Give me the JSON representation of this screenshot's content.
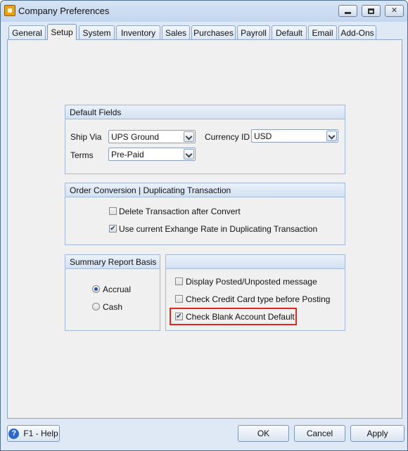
{
  "window": {
    "title": "Company Preferences",
    "close_glyph": "✕",
    "icons": {
      "app": "app-icon",
      "minimize": "minimize-icon",
      "maximize": "maximize-icon",
      "close": "close-icon"
    }
  },
  "tabs": [
    {
      "label": "General"
    },
    {
      "label": "Setup",
      "active": true
    },
    {
      "label": "System"
    },
    {
      "label": "Inventory"
    },
    {
      "label": "Sales"
    },
    {
      "label": "Purchases"
    },
    {
      "label": "Payroll"
    },
    {
      "label": "Default"
    },
    {
      "label": "Email"
    },
    {
      "label": "Add-Ons"
    }
  ],
  "default_fields": {
    "title": "Default Fields",
    "ship_via_label": "Ship Via",
    "ship_via_value": "UPS Ground",
    "terms_label": "Terms",
    "terms_value": "Pre-Paid",
    "currency_label": "Currency ID",
    "currency_value": "USD"
  },
  "order_conversion": {
    "title": "Order Conversion | Duplicating Transaction",
    "delete_label": "Delete Transaction after Convert",
    "delete_checked": false,
    "exchange_label": "Use current Exhange Rate in Duplicating Transaction",
    "exchange_checked": true
  },
  "summary_report": {
    "title": "Summary Report Basis",
    "accrual_label": "Accrual",
    "cash_label": "Cash",
    "selected": "Accrual"
  },
  "options": {
    "posted_label": "Display Posted/Unposted message",
    "posted_checked": false,
    "credit_label": "Check Credit Card type before Posting",
    "credit_checked": false,
    "blank_account_label": "Check Blank Account Default",
    "blank_account_checked": true,
    "highlight_color": "#e0261f"
  },
  "footer": {
    "help_glyph": "?",
    "help_label": "F1 - Help",
    "ok_label": "OK",
    "cancel_label": "Cancel",
    "apply_label": "Apply"
  },
  "check_glyph": "✔"
}
